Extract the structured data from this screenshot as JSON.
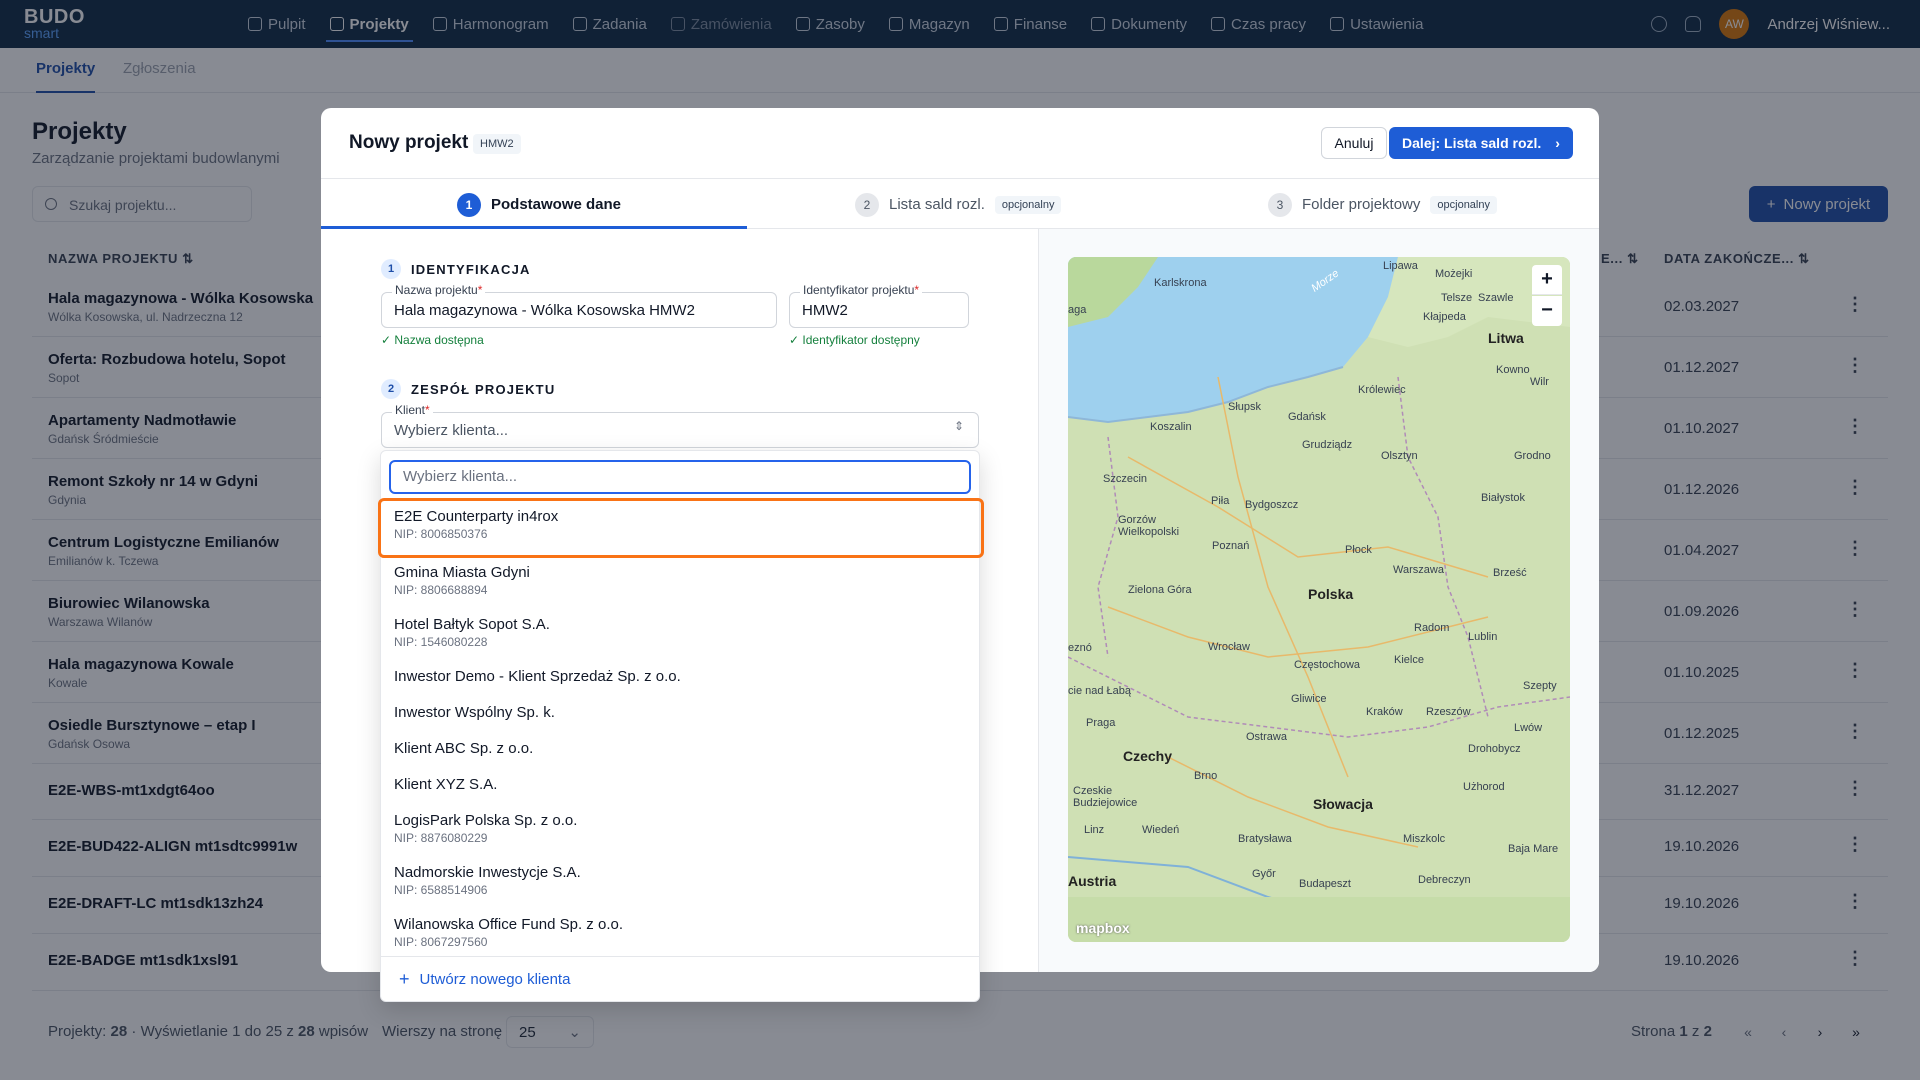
{
  "app": {
    "logo_top": "BUDO",
    "logo_bottom": "smart"
  },
  "nav": [
    {
      "label": "Pulpit",
      "icon": "home-icon"
    },
    {
      "label": "Projekty",
      "icon": "folder-icon"
    },
    {
      "label": "Harmonogram",
      "icon": "calendar-icon"
    },
    {
      "label": "Zadania",
      "icon": "clipboard-icon"
    },
    {
      "label": "Zamówienia",
      "icon": "box-icon"
    },
    {
      "label": "Zasoby",
      "icon": "layers-icon"
    },
    {
      "label": "Magazyn",
      "icon": "warehouse-icon"
    },
    {
      "label": "Finanse",
      "icon": "card-icon"
    },
    {
      "label": "Dokumenty",
      "icon": "document-icon"
    },
    {
      "label": "Czas pracy",
      "icon": "clock-icon"
    },
    {
      "label": "Ustawienia",
      "icon": "gear-icon"
    }
  ],
  "user": {
    "initials": "AW",
    "name": "Andrzej Wiśniew..."
  },
  "subtabs": [
    "Projekty",
    "Zgłoszenia"
  ],
  "page": {
    "title": "Projekty",
    "subtitle": "Zarządzanie projektami budowlanymi",
    "search_placeholder": "Szukaj projektu...",
    "new_button": "Nowy projekt"
  },
  "table": {
    "col_name": "NAZWA PROJEKTU",
    "col_end": "DATA ZAKOŃCZE...",
    "col_mid": "E...",
    "rows": [
      {
        "name": "Hala magazynowa - Wólka Kosowska",
        "sub": "Wólka Kosowska, ul. Nadrzeczna 12",
        "date": "02.03.2027"
      },
      {
        "name": "Oferta: Rozbudowa hotelu, Sopot",
        "sub": "Sopot",
        "date": "01.12.2027"
      },
      {
        "name": "Apartamenty Nadmotławie",
        "sub": "Gdańsk Śródmieście",
        "date": "01.10.2027"
      },
      {
        "name": "Remont Szkoły nr 14 w Gdyni",
        "sub": "Gdynia",
        "date": "01.12.2026"
      },
      {
        "name": "Centrum Logistyczne Emilianów",
        "sub": "Emilianów k. Tczewa",
        "date": "01.04.2027"
      },
      {
        "name": "Biurowiec Wilanowska",
        "sub": "Warszawa Wilanów",
        "date": "01.09.2026"
      },
      {
        "name": "Hala magazynowa Kowale",
        "sub": "Kowale",
        "date": "01.10.2025"
      },
      {
        "name": "Osiedle Bursztynowe – etap I",
        "sub": "Gdańsk Osowa",
        "date": "01.12.2025"
      },
      {
        "name": "E2E-WBS-mt1xdgt64oo",
        "sub": "",
        "date": "31.12.2027"
      },
      {
        "name": "E2E-BUD422-ALIGN mt1sdtc9991w",
        "sub": "",
        "date": "19.10.2026"
      },
      {
        "name": "E2E-DRAFT-LC mt1sdk13zh24",
        "sub": "",
        "date": "19.10.2026"
      },
      {
        "name": "E2E-BADGE mt1sdk1xsl91",
        "sub": "",
        "date": "19.10.2026"
      }
    ]
  },
  "footer": {
    "count_label": "Projekty:",
    "count": "28",
    "showing_pre": "Wyświetlanie 1 do 25 z",
    "showing_total": "28",
    "showing_post": "wpisów",
    "per_page_label": "Wierszy na stronę",
    "per_page": "25",
    "page_pre": "Strona",
    "page": "1",
    "page_mid": "z",
    "pages": "2"
  },
  "modal": {
    "title": "Nowy projekt",
    "code": "HMW2",
    "cancel": "Anuluj",
    "next": "Dalej: Lista sald rozl.",
    "steps": [
      {
        "num": "1",
        "label": "Podstawowe dane",
        "badge": ""
      },
      {
        "num": "2",
        "label": "Lista sald rozl.",
        "badge": "opcjonalny"
      },
      {
        "num": "3",
        "label": "Folder projektowy",
        "badge": "opcjonalny"
      }
    ],
    "sec1": {
      "num": "1",
      "title": "IDENTYFIKACJA"
    },
    "project_name": {
      "label": "Nazwa projektu",
      "value": "Hala magazynowa - Wólka Kosowska HMW2",
      "ok": "Nazwa dostępna"
    },
    "project_id": {
      "label": "Identyfikator projektu",
      "value": "HMW2",
      "ok": "Identyfikator dostępny"
    },
    "sec2": {
      "num": "2",
      "title": "ZESPÓŁ PROJEKTU"
    },
    "client": {
      "label": "Klient",
      "placeholder": "Wybierz klienta..."
    }
  },
  "dropdown": {
    "search_placeholder": "Wybierz klienta...",
    "options": [
      {
        "name": "E2E Counterparty in4rox",
        "nip": "NIP: 8006850376"
      },
      {
        "name": "Gmina Miasta Gdyni",
        "nip": "NIP: 8806688894"
      },
      {
        "name": "Hotel Bałtyk Sopot S.A.",
        "nip": "NIP: 1546080228"
      },
      {
        "name": "Inwestor Demo - Klient Sprzedaż Sp. z o.o.",
        "nip": ""
      },
      {
        "name": "Inwestor Wspólny Sp. k.",
        "nip": ""
      },
      {
        "name": "Klient ABC Sp. z o.o.",
        "nip": ""
      },
      {
        "name": "Klient XYZ S.A.",
        "nip": ""
      },
      {
        "name": "LogisPark Polska Sp. z o.o.",
        "nip": "NIP: 8876080229"
      },
      {
        "name": "Nadmorskie Inwestycje S.A.",
        "nip": "NIP: 6588514906"
      },
      {
        "name": "Wilanowska Office Fund Sp. z o.o.",
        "nip": "NIP: 8067297560"
      }
    ],
    "create": "Utwórz nowego klienta"
  },
  "map": {
    "labels": [
      "Lipawa",
      "Możejki",
      "Karlskrona",
      "Telsze",
      "Szawle",
      "Kłajpeda",
      "Litwa",
      "aga",
      "Kowno",
      "Wilr",
      "Królewiec",
      "Słupsk",
      "Koszalin",
      "Gdańsk",
      "Olsztyn",
      "Grudziądz",
      "Grodno",
      "Szczecin",
      "Piła",
      "Bydgoszcz",
      "Białystok",
      "Gorzów Wielkopolski",
      "Poznań",
      "Płock",
      "Warszawa",
      "Brześć",
      "Zielona Góra",
      "Polska",
      "Radom",
      "Lublin",
      "Wrocław",
      "Kielce",
      "Częstochowa",
      "Gliwice",
      "Kraków",
      "Rzeszów",
      "Praga",
      "Czechy",
      "Ostrawa",
      "Brno",
      "Słowacja",
      "Użhorod",
      "Wiedeń",
      "Bratysława",
      "Miszkolc",
      "Austria",
      "Budapeszt",
      "Debreczyn",
      "Drohobycz",
      "Lwów",
      "Szepty",
      "Baja Mare",
      "Linz",
      "Czeskie Budziejowice",
      "Győr",
      "eznó",
      "cie nad Łabą",
      "Morze"
    ],
    "brand": "mapbox",
    "zoom_in": "+",
    "zoom_out": "−"
  },
  "colors": {
    "topbar": "#0f2a44",
    "primary": "#1e5dd6",
    "highlight": "#f97316",
    "success": "#15803d"
  }
}
